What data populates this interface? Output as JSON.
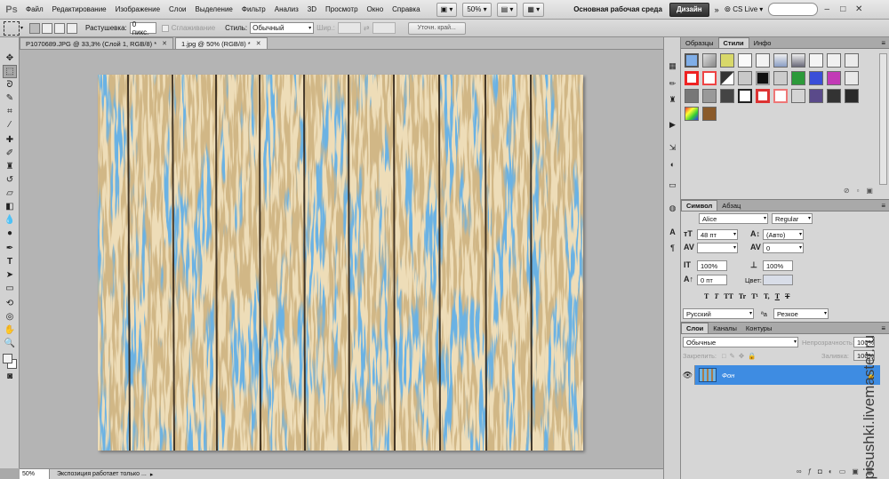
{
  "app": {
    "logo": "Ps"
  },
  "menu": [
    "Файл",
    "Редактирование",
    "Изображение",
    "Слои",
    "Выделение",
    "Фильтр",
    "Анализ",
    "3D",
    "Просмотр",
    "Окно",
    "Справка"
  ],
  "menubar": {
    "zoom": "50%",
    "workspace_label": "Основная рабочая среда",
    "design_button": "Дизайн",
    "cs_live": "CS Live"
  },
  "options": {
    "feather_label": "Растушевка:",
    "feather_value": "0 пикс.",
    "antialias_label": "Сглаживание",
    "style_label": "Стиль:",
    "style_value": "Обычный",
    "width_label": "Шир.:",
    "refine_button": "Уточн. край..."
  },
  "tabs": [
    {
      "label": "P1070689.JPG @ 33,3% (Слой 1, RGB/8) *",
      "active": false
    },
    {
      "label": "1.jpg @ 50% (RGB/8) *",
      "active": true
    }
  ],
  "status": {
    "zoom": "50%",
    "text": "Экспозиция работает только ..."
  },
  "panels": {
    "styles_tabs": [
      "Образцы",
      "Стили",
      "Инфо"
    ],
    "char_tabs": [
      "Символ",
      "Абзац"
    ],
    "font_family": "Alice",
    "font_style": "Regular",
    "font_size": "48 пт",
    "leading": "(Авто)",
    "kerning": "",
    "tracking": "0",
    "vscale": "100%",
    "hscale": "100%",
    "baseline": "0 пт",
    "color_label": "Цвет:",
    "language": "Русский",
    "aa_label": "ªa",
    "antialias": "Резкое",
    "format_buttons": [
      "T",
      "T",
      "TT",
      "Tr",
      "T¹",
      "T,",
      "T",
      "T"
    ],
    "layers_tabs": [
      "Слои",
      "Каналы",
      "Контуры"
    ],
    "blend_mode": "Обычные",
    "opacity_label": "Непрозрачность:",
    "opacity_value": "100%",
    "lock_label": "Закрепить:",
    "fill_label": "Заливка:",
    "fill_value": "100%",
    "layer_name": "Фон"
  },
  "watermark": "raspisushki.livemaster.ru"
}
